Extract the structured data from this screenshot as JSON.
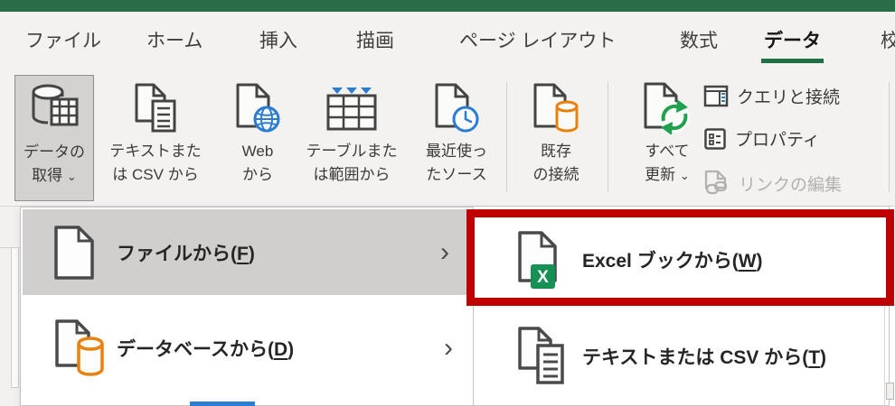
{
  "colors": {
    "titlebar_green": "#276e49",
    "tab_accent_green": "#1e7145",
    "annotation_red": "#c00000",
    "menu_highlight_gray": "#d1cfcd",
    "icon_blue": "#2b7cd3",
    "icon_orange": "#e8820c",
    "refresh_green": "#21a04f",
    "excel_badge_green": "#169154"
  },
  "icons": {
    "chevron_down": "⌄",
    "submenu_arrow": "›"
  },
  "tabs": {
    "items": [
      {
        "label": "ファイル"
      },
      {
        "label": "ホーム"
      },
      {
        "label": "挿入"
      },
      {
        "label": "描画"
      },
      {
        "label": "ページ レイアウト"
      },
      {
        "label": "数式"
      },
      {
        "label": "データ",
        "selected": true
      },
      {
        "label": "校閲"
      }
    ]
  },
  "ribbon": {
    "get_data": {
      "line1": "データの",
      "line2": "取得"
    },
    "text_csv": {
      "line1": "テキストまた",
      "line2": "は CSV から"
    },
    "from_web": {
      "line1": "Web",
      "line2": "から"
    },
    "table_range": {
      "line1": "テーブルまた",
      "line2": "は範囲から"
    },
    "recent_sources": {
      "line1": "最近使っ",
      "line2": "たソース"
    },
    "existing_connections": {
      "line1": "既存",
      "line2": "の接続"
    },
    "refresh_all": {
      "line1": "すべて",
      "line2": "更新"
    },
    "queries_connections_label": "クエリと接続",
    "properties_label": "プロパティ",
    "edit_links_label": "リンクの編集"
  },
  "get_data_menu": {
    "from_file": {
      "pre": "ファイルから(",
      "key": "F",
      "post": ")"
    },
    "from_database": {
      "pre": "データベースから(",
      "key": "D",
      "post": ")"
    }
  },
  "file_submenu": {
    "from_workbook": {
      "pre": "Excel ブックから(",
      "key": "W",
      "post": ")"
    },
    "from_text_csv": {
      "pre": "テキストまたは CSV から(",
      "key": "T",
      "post": ")"
    },
    "excel_badge_letter": "X"
  }
}
